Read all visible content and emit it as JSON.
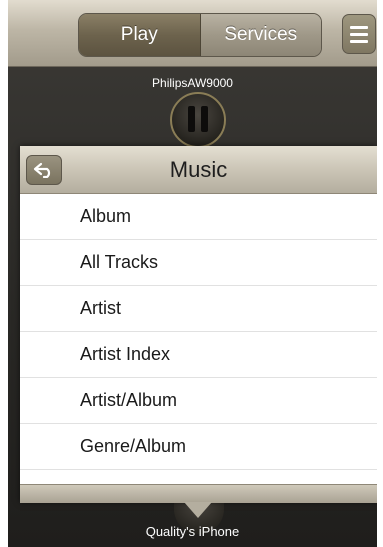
{
  "toolbar": {
    "tabs": [
      {
        "label": "Play",
        "selected": true
      },
      {
        "label": "Services",
        "selected": false
      }
    ],
    "menu_icon": "hamburger-menu-icon"
  },
  "device": {
    "name": "PhilipsAW9000",
    "state_icon": "pause-icon"
  },
  "popup": {
    "title": "Music",
    "back_icon": "back-arrow-icon",
    "items": [
      {
        "label": "Album"
      },
      {
        "label": "All Tracks"
      },
      {
        "label": "Artist"
      },
      {
        "label": "Artist Index"
      },
      {
        "label": "Artist/Album"
      },
      {
        "label": "Genre/Album"
      }
    ]
  },
  "source": {
    "label": "Quality's iPhone"
  }
}
